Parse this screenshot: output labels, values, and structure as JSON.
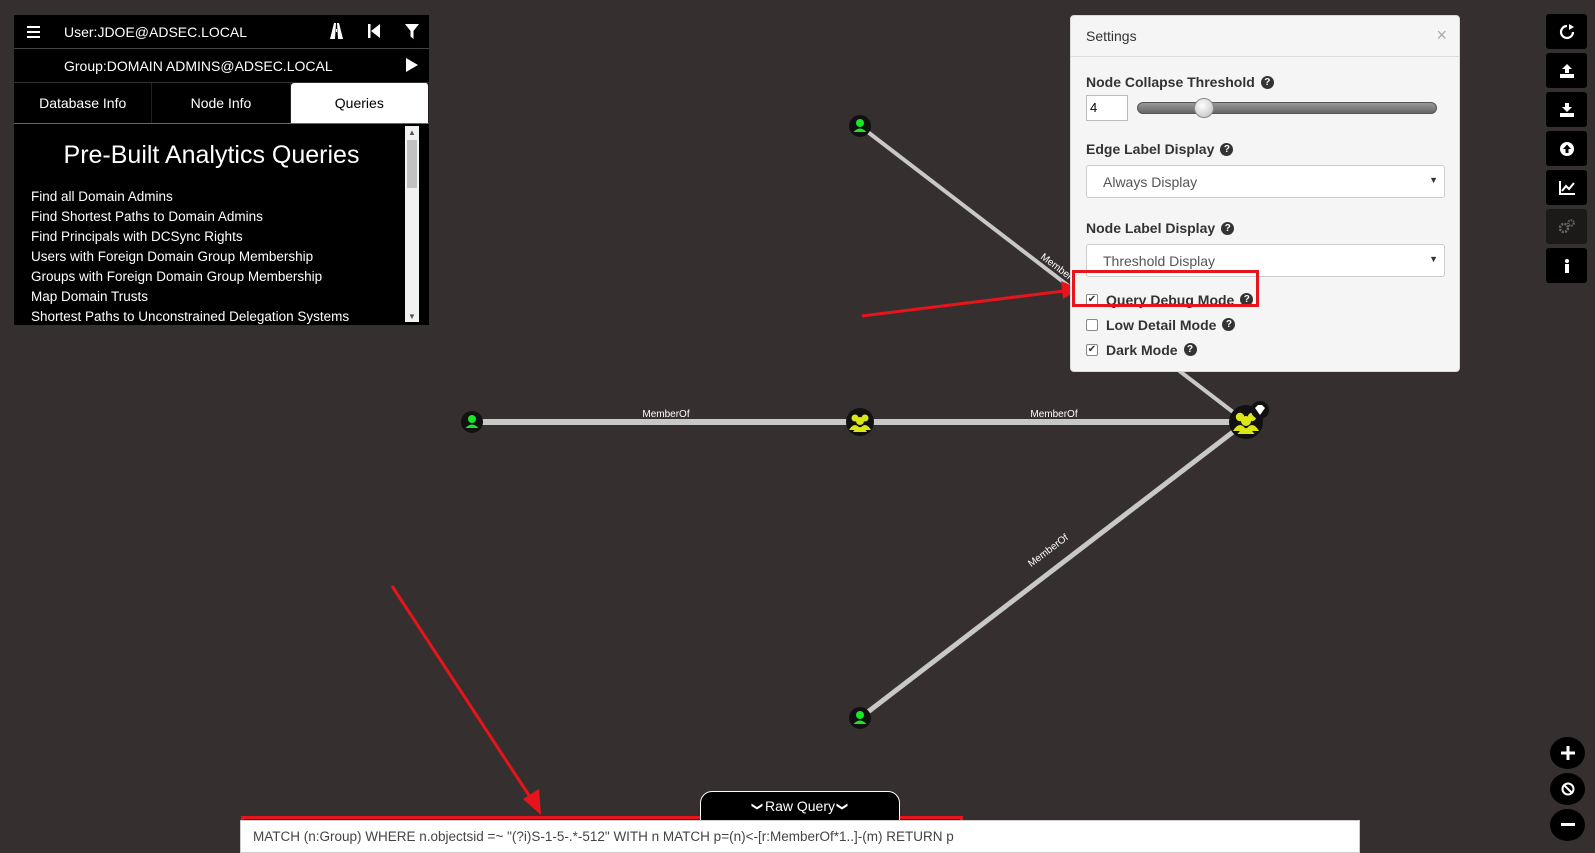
{
  "search": {
    "start_node": "User:JDOE@ADSEC.LOCAL",
    "end_node": "Group:DOMAIN ADMINS@ADSEC.LOCAL"
  },
  "tabs": [
    {
      "label": "Database Info",
      "active": false
    },
    {
      "label": "Node Info",
      "active": false
    },
    {
      "label": "Queries",
      "active": true
    }
  ],
  "queries": {
    "title": "Pre-Built Analytics Queries",
    "items": [
      "Find all Domain Admins",
      "Find Shortest Paths to Domain Admins",
      "Find Principals with DCSync Rights",
      "Users with Foreign Domain Group Membership",
      "Groups with Foreign Domain Group Membership",
      "Map Domain Trusts",
      "Shortest Paths to Unconstrained Delegation Systems"
    ]
  },
  "settings": {
    "title": "Settings",
    "close": "×",
    "collapse_threshold_label": "Node Collapse Threshold",
    "collapse_threshold_value": "4",
    "collapse_threshold_fraction": 0.2,
    "edge_label_display_label": "Edge Label Display",
    "edge_label_display_value": "Always Display",
    "node_label_display_label": "Node Label Display",
    "node_label_display_value": "Threshold Display",
    "checkboxes": [
      {
        "label": "Query Debug Mode",
        "checked": true
      },
      {
        "label": "Low Detail Mode",
        "checked": false
      },
      {
        "label": "Dark Mode",
        "checked": true
      }
    ]
  },
  "graph": {
    "edge_label": "MemberOf"
  },
  "raw_query": {
    "toggle_label": "Raw Query",
    "value": "MATCH (n:Group) WHERE n.objectsid =~ \"(?i)S-1-5-.*-512\" WITH n MATCH p=(n)<-[r:MemberOf*1..]-(m) RETURN p"
  },
  "colors": {
    "background": "#35302f",
    "user_node": "#17e625",
    "group_node": "#dbe617",
    "highlight": "#e8141b"
  },
  "icons": {
    "toolbar": [
      "refresh-icon",
      "export-icon",
      "import-icon",
      "upload-icon",
      "chart-icon",
      "settings-icon",
      "info-icon"
    ],
    "zoom": [
      "zoom-in-icon",
      "zoom-reset-icon",
      "zoom-out-icon"
    ]
  }
}
